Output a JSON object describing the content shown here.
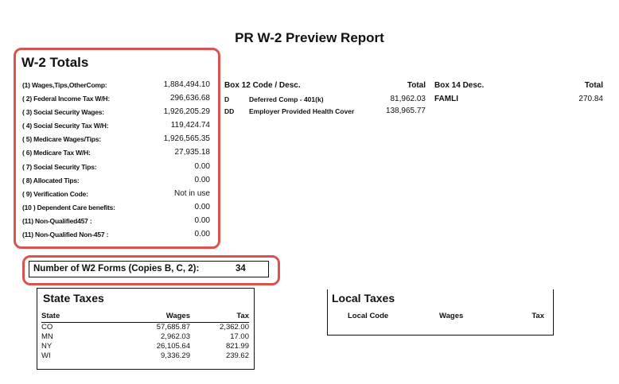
{
  "report": {
    "title": "PR W-2 Preview Report"
  },
  "w2_totals": {
    "title": "W-2 Totals",
    "rows": [
      {
        "label": "(1) Wages,Tips,OtherComp:",
        "value": "1,884,494.10"
      },
      {
        "label": "( 2) Federal Income Tax W/H:",
        "value": "296,636.68"
      },
      {
        "label": "( 3) Social Security Wages:",
        "value": "1,926,205.29"
      },
      {
        "label": "( 4) Social Security Tax W/H:",
        "value": "119,424.74"
      },
      {
        "label": "( 5) Medicare Wages/Tips:",
        "value": "1,926,565.35"
      },
      {
        "label": "( 6) Medicare Tax W/H:",
        "value": "27,935.18"
      },
      {
        "label": "( 7) Social Security Tips:",
        "value": "0.00"
      },
      {
        "label": "( 8) Allocated Tips:",
        "value": "0.00"
      },
      {
        "label": "( 9) Verification Code:",
        "value": "Not in use"
      },
      {
        "label": "(10 ) Dependent Care benefits:",
        "value": "0.00"
      },
      {
        "label": "(11) Non-Qualified457 :",
        "value": "0.00"
      },
      {
        "label": "(11) Non-Qualified Non-457 :",
        "value": "0.00"
      }
    ]
  },
  "w2_forms": {
    "label": "Number of W2 Forms (Copies B, C, 2):",
    "value": "34"
  },
  "box12": {
    "header_code": "Box 12 Code / Desc.",
    "header_total": "Total",
    "rows": [
      {
        "code": "D",
        "desc": "Deferred Comp - 401(k)",
        "total": "81,962.03"
      },
      {
        "code": "DD",
        "desc": "Employer Provided Health Cover",
        "total": "138,965.77"
      }
    ]
  },
  "box14": {
    "header_desc": "Box 14 Desc.",
    "header_total": "Total",
    "rows": [
      {
        "desc": "FAMLI",
        "total": "270.84"
      }
    ]
  },
  "state_taxes": {
    "title": "State Taxes",
    "headers": {
      "state": "State",
      "wages": "Wages",
      "tax": "Tax"
    },
    "rows": [
      {
        "state": "CO",
        "wages": "57,685.87",
        "tax": "2,362.00"
      },
      {
        "state": "MN",
        "wages": "2,962.03",
        "tax": "17.00"
      },
      {
        "state": "NY",
        "wages": "26,105.64",
        "tax": "821.99"
      },
      {
        "state": "WI",
        "wages": "9,336.29",
        "tax": "239.62"
      }
    ]
  },
  "local_taxes": {
    "title": "Local Taxes",
    "headers": {
      "code": "Local Code",
      "wages": "Wages",
      "tax": "Tax"
    }
  },
  "colors": {
    "highlight_ring": "#d9534f"
  }
}
